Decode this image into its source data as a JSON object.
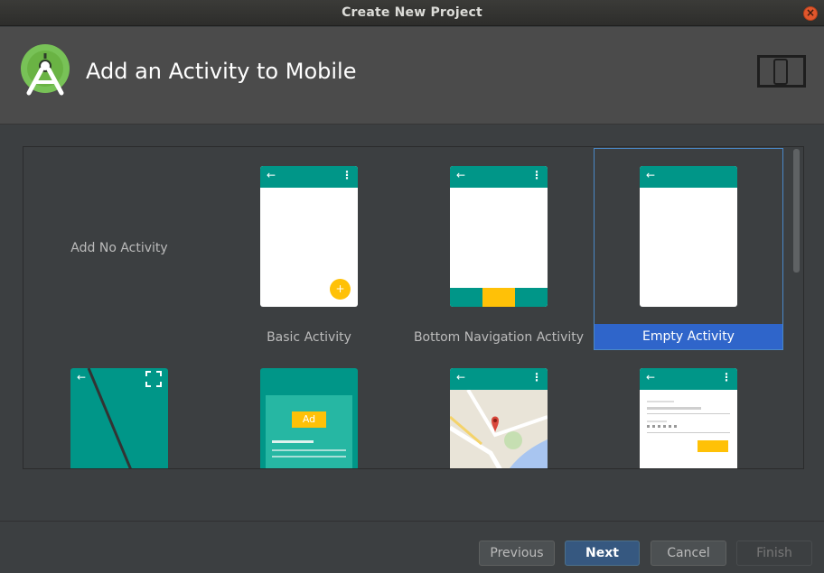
{
  "window": {
    "title": "Create New Project"
  },
  "header": {
    "title": "Add an Activity to Mobile"
  },
  "colors": {
    "accent": "#009688",
    "selection": "#2f65ca",
    "fab": "#ffc107",
    "header_bg": "#4b4b4b",
    "dialog_bg": "#3c3f41"
  },
  "tiles": [
    {
      "label": "Add No Activity"
    },
    {
      "label": "Basic Activity"
    },
    {
      "label": "Bottom Navigation Activity"
    },
    {
      "label": "Empty Activity",
      "selected": true
    },
    {
      "label": ""
    },
    {
      "label": ""
    },
    {
      "label": ""
    },
    {
      "label": ""
    }
  ],
  "icons": {
    "back": "←",
    "more": "⋮",
    "fab_plus": "+",
    "ad_badge": "Ad",
    "close": "×"
  },
  "buttons": {
    "previous": "Previous",
    "next": "Next",
    "cancel": "Cancel",
    "finish": "Finish"
  }
}
